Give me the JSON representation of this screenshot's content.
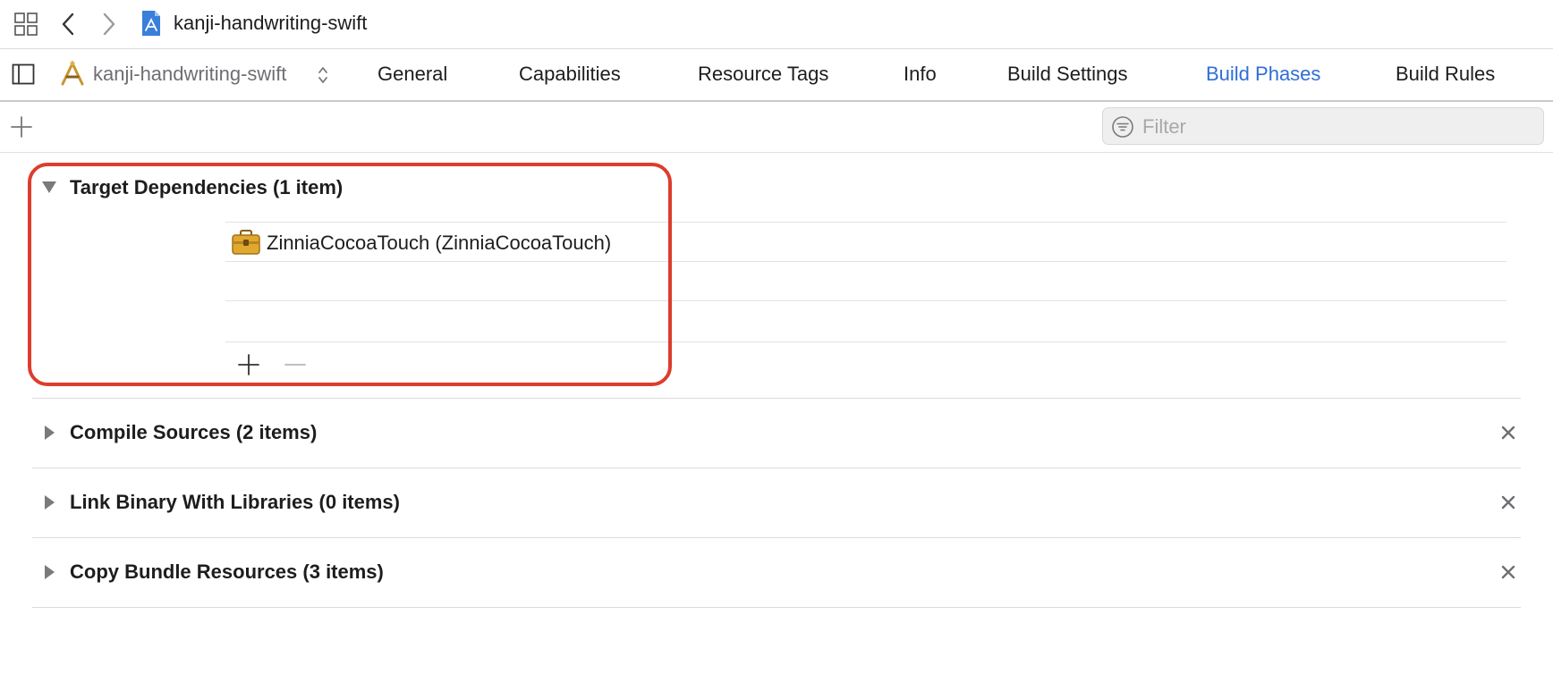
{
  "navbar": {
    "project_title": "kanji-handwriting-swift"
  },
  "tabbar": {
    "target_name": "kanji-handwriting-swift",
    "tabs": [
      {
        "label": "General",
        "active": false
      },
      {
        "label": "Capabilities",
        "active": false
      },
      {
        "label": "Resource Tags",
        "active": false
      },
      {
        "label": "Info",
        "active": false
      },
      {
        "label": "Build Settings",
        "active": false
      },
      {
        "label": "Build Phases",
        "active": true
      },
      {
        "label": "Build Rules",
        "active": false
      }
    ]
  },
  "toolbar": {
    "filter_placeholder": "Filter"
  },
  "phases": [
    {
      "title": "Target Dependencies (1 item)",
      "expanded": true,
      "items": [
        "ZinniaCocoaTouch (ZinniaCocoaTouch)"
      ]
    },
    {
      "title": "Compile Sources (2 items)",
      "expanded": false
    },
    {
      "title": "Link Binary With Libraries (0 items)",
      "expanded": false
    },
    {
      "title": "Copy Bundle Resources (3 items)",
      "expanded": false
    }
  ],
  "colors": {
    "accent": "#2f6ed8",
    "highlight": "#dd3d2d",
    "icon_gray": "#6e6e73"
  },
  "icons": {
    "grid": "grid-icon",
    "back": "chevron-left-icon",
    "forward": "chevron-right-icon",
    "project": "xcode-project-icon",
    "sidebar": "sidebar-toggle-icon",
    "target": "app-target-icon",
    "stepper": "chevron-up-down-icon",
    "add": "plus-icon",
    "filter": "filter-icon",
    "framework": "framework-toolbox-icon",
    "remove": "minus-icon",
    "close": "close-icon"
  }
}
